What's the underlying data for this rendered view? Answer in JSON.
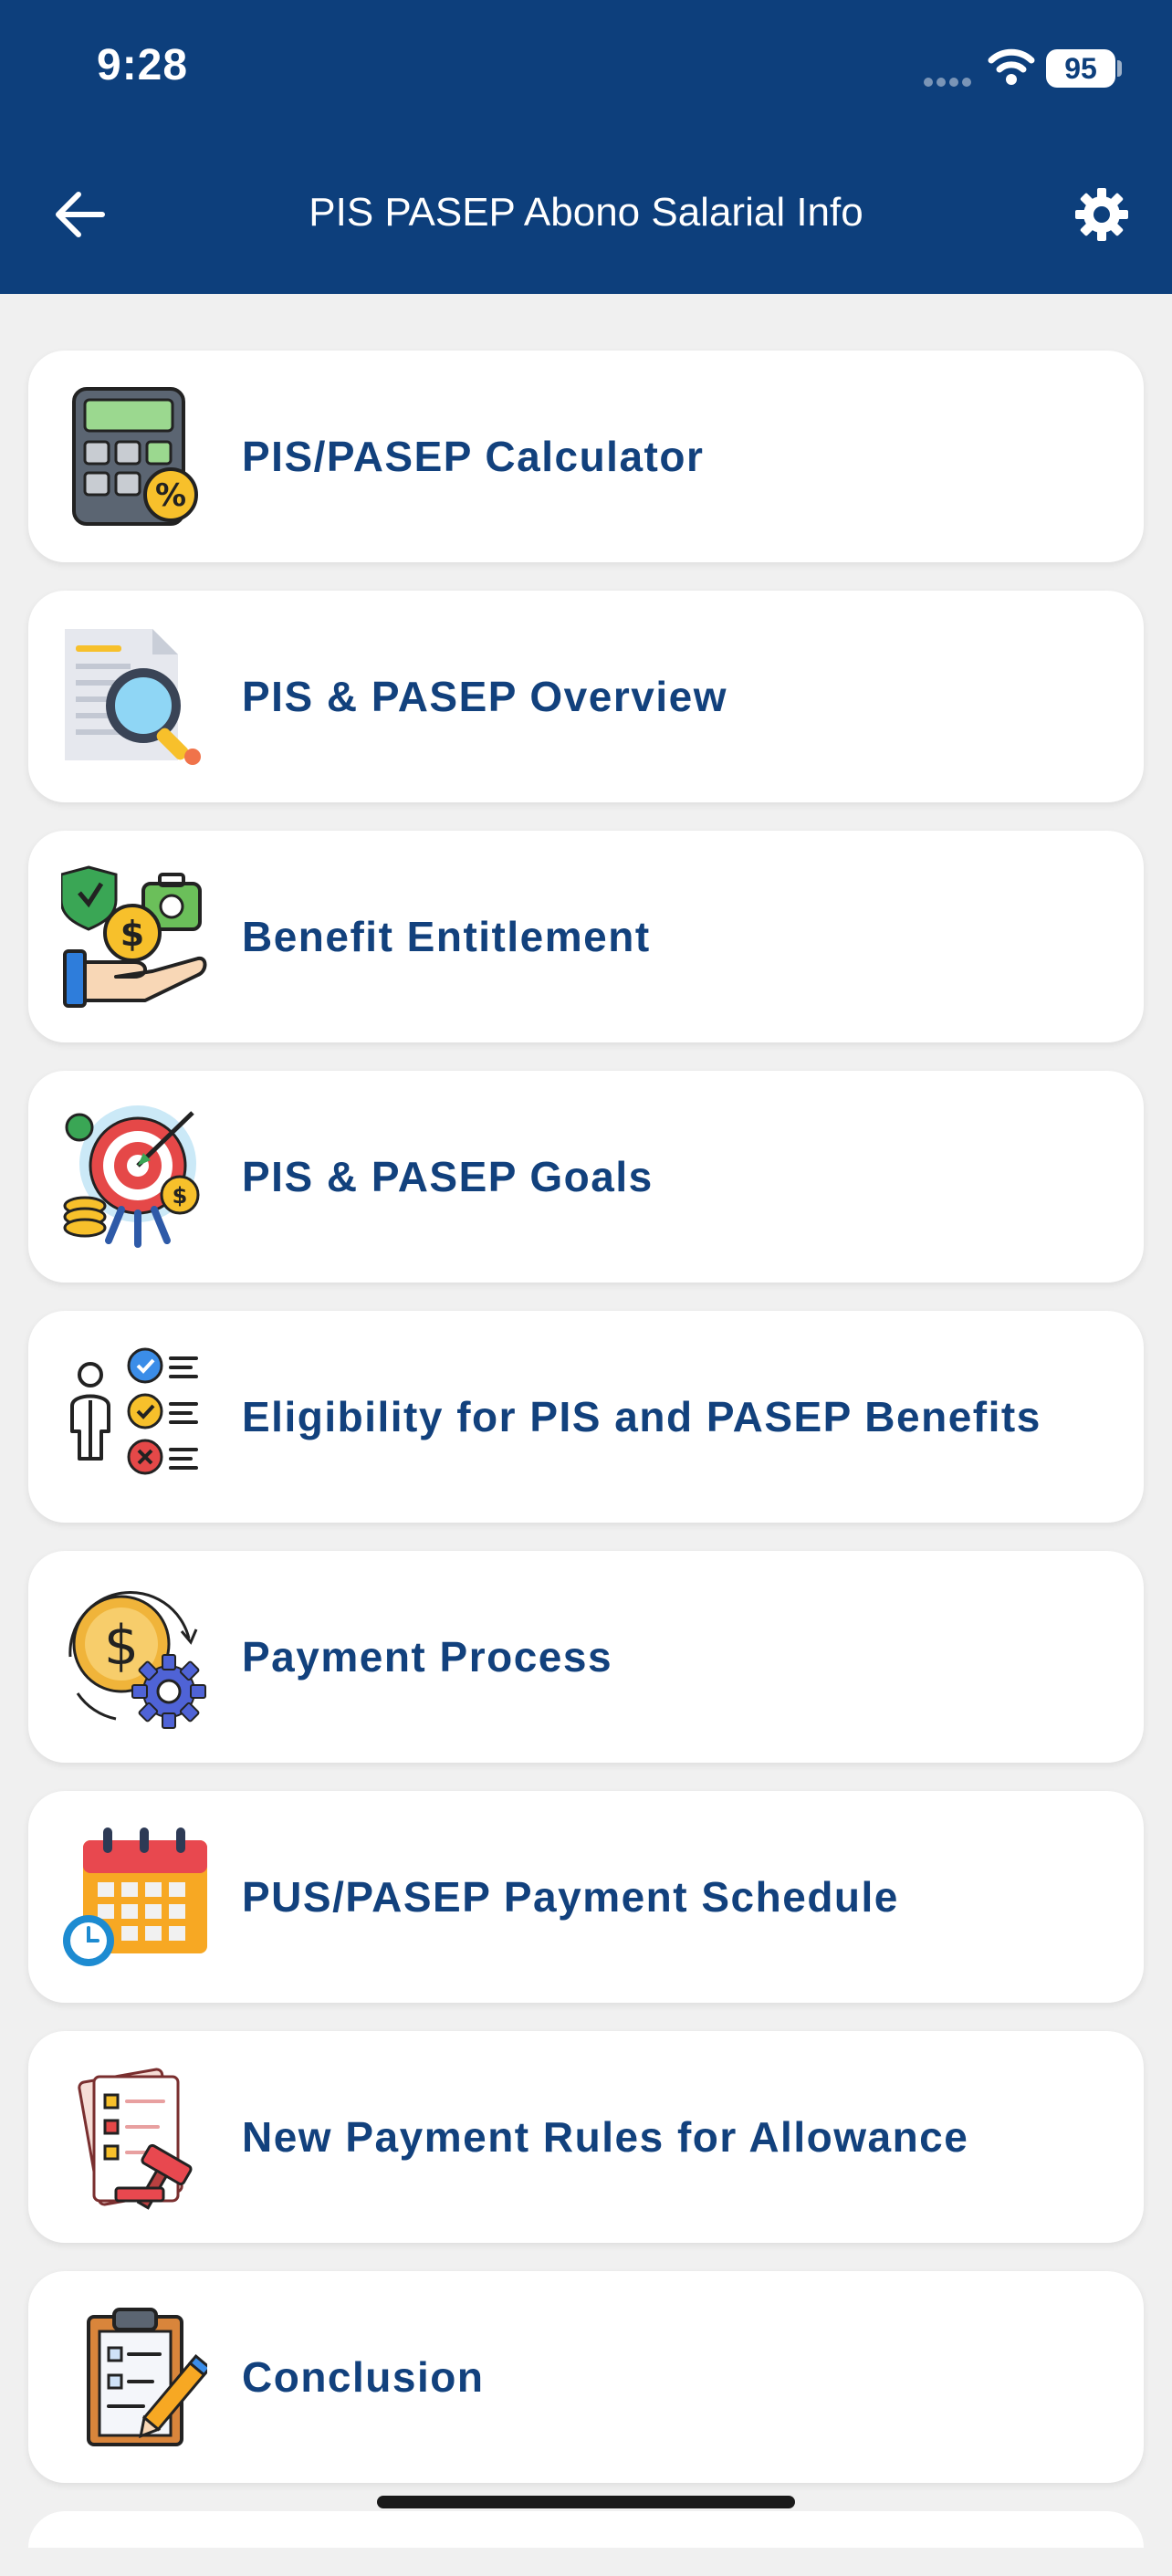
{
  "status_bar": {
    "time": "9:28",
    "battery": "95"
  },
  "header": {
    "title": "PIS PASEP Abono Salarial Info",
    "back_icon": "back-arrow-icon",
    "settings_icon": "gear-icon"
  },
  "colors": {
    "header_bg": "#0d3f7c",
    "label_text": "#12417d",
    "card_bg": "#ffffff",
    "page_bg": "#f0f0f0"
  },
  "menu": {
    "items": [
      {
        "label": "PIS/PASEP Calculator",
        "icon": "calculator-icon"
      },
      {
        "label": "PIS & PASEP Overview",
        "icon": "document-search-icon"
      },
      {
        "label": "Benefit Entitlement",
        "icon": "hand-money-icon"
      },
      {
        "label": "PIS & PASEP Goals",
        "icon": "target-goals-icon"
      },
      {
        "label": "Eligibility for PIS and PASEP Benefits",
        "icon": "checklist-person-icon"
      },
      {
        "label": "Payment Process",
        "icon": "coin-gear-icon"
      },
      {
        "label": "PUS/PASEP Payment Schedule",
        "icon": "calendar-clock-icon"
      },
      {
        "label": "New Payment Rules for Allowance",
        "icon": "rules-gavel-icon"
      },
      {
        "label": "Conclusion",
        "icon": "clipboard-pen-icon"
      }
    ]
  }
}
